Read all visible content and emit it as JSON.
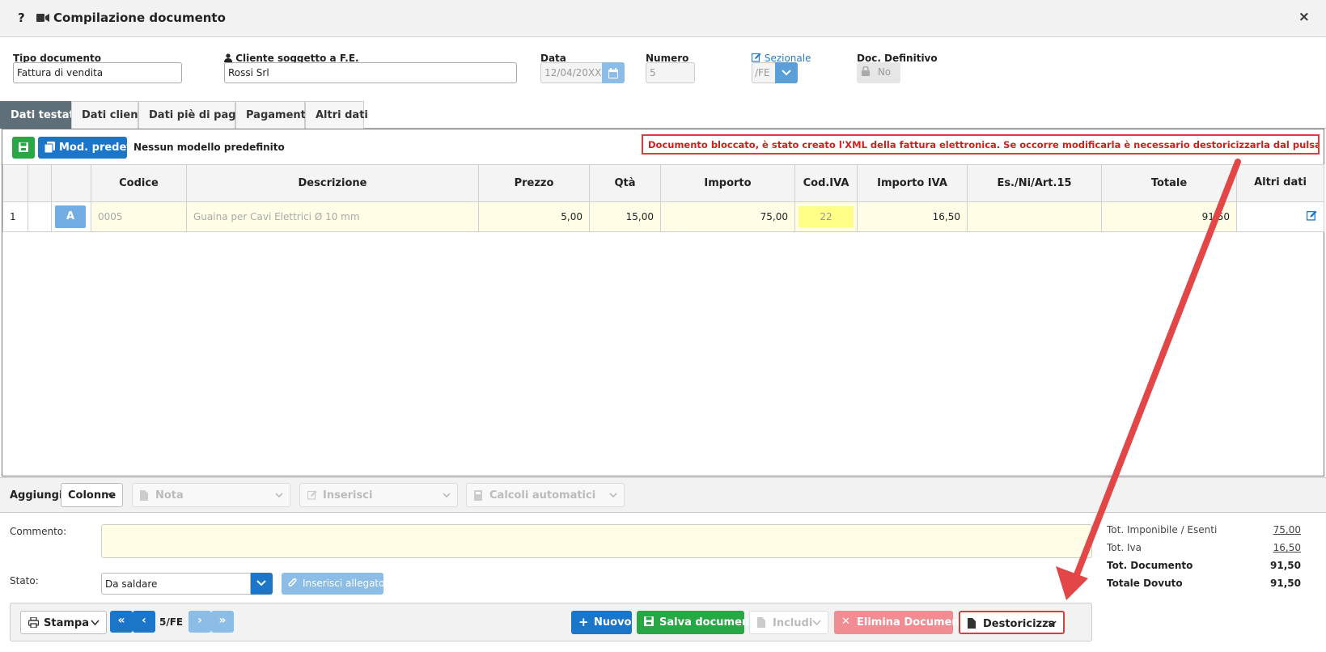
{
  "window": {
    "title": "Compilazione documento",
    "help": "?",
    "close": "×"
  },
  "header": {
    "tipo_label": "Tipo documento",
    "tipo_value": "Fattura di vendita",
    "cliente_label": "Cliente soggetto a F.E.",
    "cliente_value": "Rossi Srl",
    "data_label": "Data",
    "data_value": "12/04/20XX",
    "numero_label": "Numero",
    "numero_value": "5",
    "sezionale_label": "Sezionale",
    "sezionale_value": "/FE",
    "definitivo_label": "Doc. Definitivo",
    "definitivo_value": "No"
  },
  "tabs": [
    "Dati testata",
    "Dati clienti",
    "Dati piè di pagina",
    "Pagamento",
    "Altri dati"
  ],
  "toolbar": {
    "mod_label": "Mod. predef.",
    "nessun": "Nessun modello predefinito",
    "warning": "Documento bloccato, è stato creato l'XML della fattura elettronica. Se occorre modificarla è necessario destoricizzarla dal pulsante \"Destoricizza\""
  },
  "table": {
    "headers": [
      "",
      "",
      "",
      "Codice",
      "Descrizione",
      "Prezzo",
      "Qtà",
      "Importo",
      "Cod.IVA",
      "Importo IVA",
      "Es./Ni/Art.15",
      "Totale",
      "Altri dati"
    ],
    "rows": [
      {
        "n": "1",
        "badge": "A",
        "codice": "0005",
        "descrizione": "Guaina per Cavi Elettrici Ø 10 mm",
        "prezzo": "5,00",
        "qta": "15,00",
        "importo": "75,00",
        "cod_iva": "22",
        "importo_iva": "16,50",
        "es": "",
        "totale": "91,50"
      }
    ]
  },
  "addbar": {
    "label": "Aggiungi:",
    "colonne": "Colonne",
    "nota": "Nota",
    "inserisci": "Inserisci",
    "calcoli": "Calcoli automatici"
  },
  "comment": {
    "label": "Commento:",
    "value": ""
  },
  "stato": {
    "label": "Stato:",
    "value": "Da saldare",
    "allegato": "Inserisci allegato"
  },
  "totals": {
    "imponibile_label": "Tot. Imponibile / Esenti",
    "imponibile": "75,00",
    "iva_label": "Tot. Iva",
    "iva": "16,50",
    "documento_label": "Tot. Documento",
    "documento": "91,50",
    "dovuto_label": "Totale Dovuto",
    "dovuto": "91,50"
  },
  "footer": {
    "stampa": "Stampa",
    "nav_label": "5/FE",
    "nuovo": "Nuovo",
    "salva": "Salva documento",
    "includi": "Includi",
    "elimina": "Elimina Documento",
    "destoricizza": "Destoricizza"
  },
  "colors": {
    "primary": "#1b76c9",
    "success": "#28a745",
    "danger": "#e03b3b",
    "highlight": "#fffde5"
  }
}
